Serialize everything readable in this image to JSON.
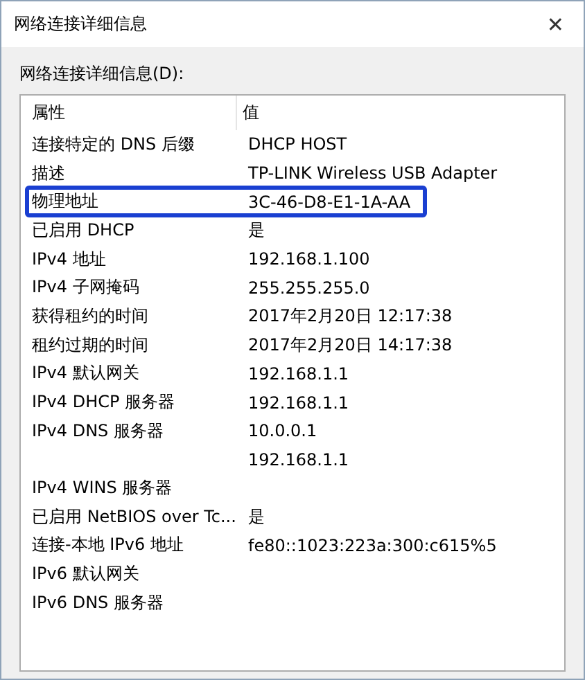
{
  "window": {
    "title": "网络连接详细信息",
    "close": "✕"
  },
  "list_label": "网络连接详细信息(D):",
  "table": {
    "columns": [
      "属性",
      "值"
    ],
    "rows": [
      {
        "property": "连接特定的 DNS 后缀",
        "value": "DHCP HOST",
        "highlighted": false
      },
      {
        "property": "描述",
        "value": "TP-LINK Wireless USB Adapter",
        "highlighted": false
      },
      {
        "property": "物理地址",
        "value": "3C-46-D8-E1-1A-AA",
        "highlighted": true
      },
      {
        "property": "已启用 DHCP",
        "value": "是",
        "highlighted": false
      },
      {
        "property": "IPv4 地址",
        "value": "192.168.1.100",
        "highlighted": false
      },
      {
        "property": "IPv4 子网掩码",
        "value": "255.255.255.0",
        "highlighted": false
      },
      {
        "property": "获得租约的时间",
        "value": "2017年2月20日 12:17:38",
        "highlighted": false
      },
      {
        "property": "租约过期的时间",
        "value": "2017年2月20日 14:17:38",
        "highlighted": false
      },
      {
        "property": "IPv4 默认网关",
        "value": "192.168.1.1",
        "highlighted": false
      },
      {
        "property": "IPv4 DHCP 服务器",
        "value": "192.168.1.1",
        "highlighted": false
      },
      {
        "property": "IPv4 DNS 服务器",
        "value": "10.0.0.1",
        "highlighted": false
      },
      {
        "value": "192.168.1.1",
        "highlighted": false
      },
      {
        "property": "IPv4 WINS 服务器",
        "highlighted": false
      },
      {
        "property": "已启用 NetBIOS over Tc...",
        "value": "是",
        "highlighted": false
      },
      {
        "property": "连接-本地 IPv6 地址",
        "value": "fe80::1023:223a:300:c615%5",
        "highlighted": false
      },
      {
        "property": "IPv6 默认网关",
        "highlighted": false
      },
      {
        "property": "IPv6 DNS 服务器",
        "highlighted": false
      }
    ]
  }
}
